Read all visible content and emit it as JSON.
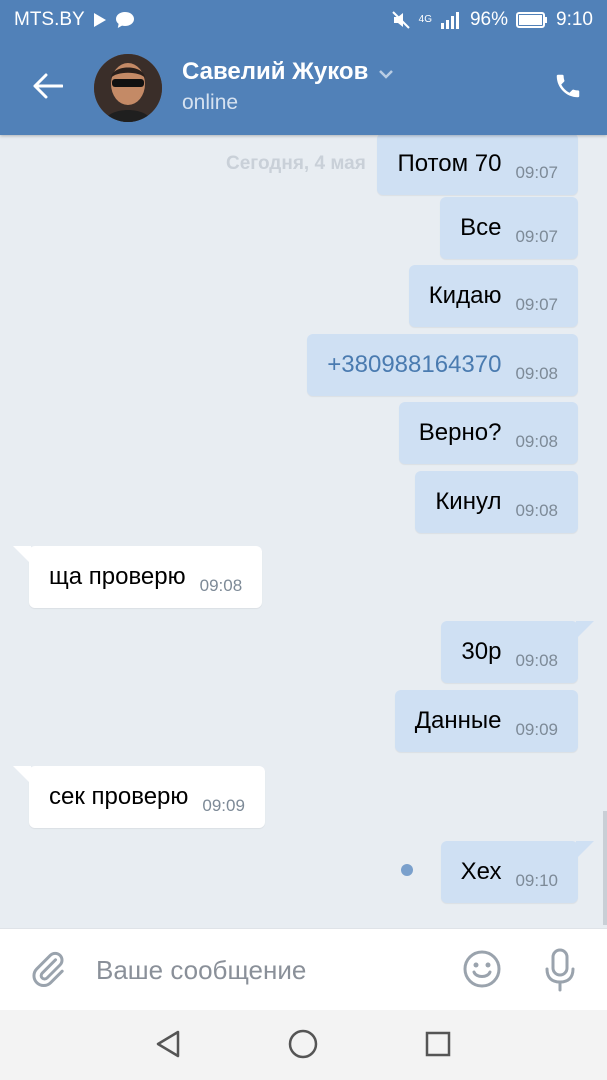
{
  "status_bar": {
    "carrier": "MTS.BY",
    "battery": "96%",
    "time": "9:10",
    "network": "4G"
  },
  "header": {
    "contact_name": "Савелий Жуков",
    "contact_status": "online"
  },
  "date_separator": "Сегодня, 4 мая",
  "messages": [
    {
      "text": "Потом 70",
      "time": "09:07",
      "direction": "out"
    },
    {
      "text": "Все",
      "time": "09:07",
      "direction": "out"
    },
    {
      "text": "Кидаю",
      "time": "09:07",
      "direction": "out"
    },
    {
      "text": "+380988164370",
      "time": "09:08",
      "direction": "out",
      "is_link": true
    },
    {
      "text": "Верно?",
      "time": "09:08",
      "direction": "out"
    },
    {
      "text": "Кинул",
      "time": "09:08",
      "direction": "out"
    },
    {
      "text": "ща проверю",
      "time": "09:08",
      "direction": "in"
    },
    {
      "text": "30р",
      "time": "09:08",
      "direction": "out"
    },
    {
      "text": "Данные",
      "time": "09:09",
      "direction": "out"
    },
    {
      "text": "сек проверю",
      "time": "09:09",
      "direction": "in"
    },
    {
      "text": "Хех",
      "time": "09:10",
      "direction": "out",
      "unread": true
    }
  ],
  "composer": {
    "placeholder": "Ваше сообщение",
    "value": ""
  },
  "colors": {
    "header": "#5181b8",
    "outgoing_bubble": "#cfe0f3",
    "incoming_bubble": "#ffffff",
    "background": "#e8edf2",
    "link": "#4a7bb0"
  },
  "icons": {
    "back": "arrow-left-icon",
    "call": "phone-icon",
    "attach": "paperclip-icon",
    "emoji": "smiley-icon",
    "mic": "microphone-icon",
    "nav_back": "triangle-back-icon",
    "nav_home": "circle-home-icon",
    "nav_recent": "square-recent-icon"
  }
}
